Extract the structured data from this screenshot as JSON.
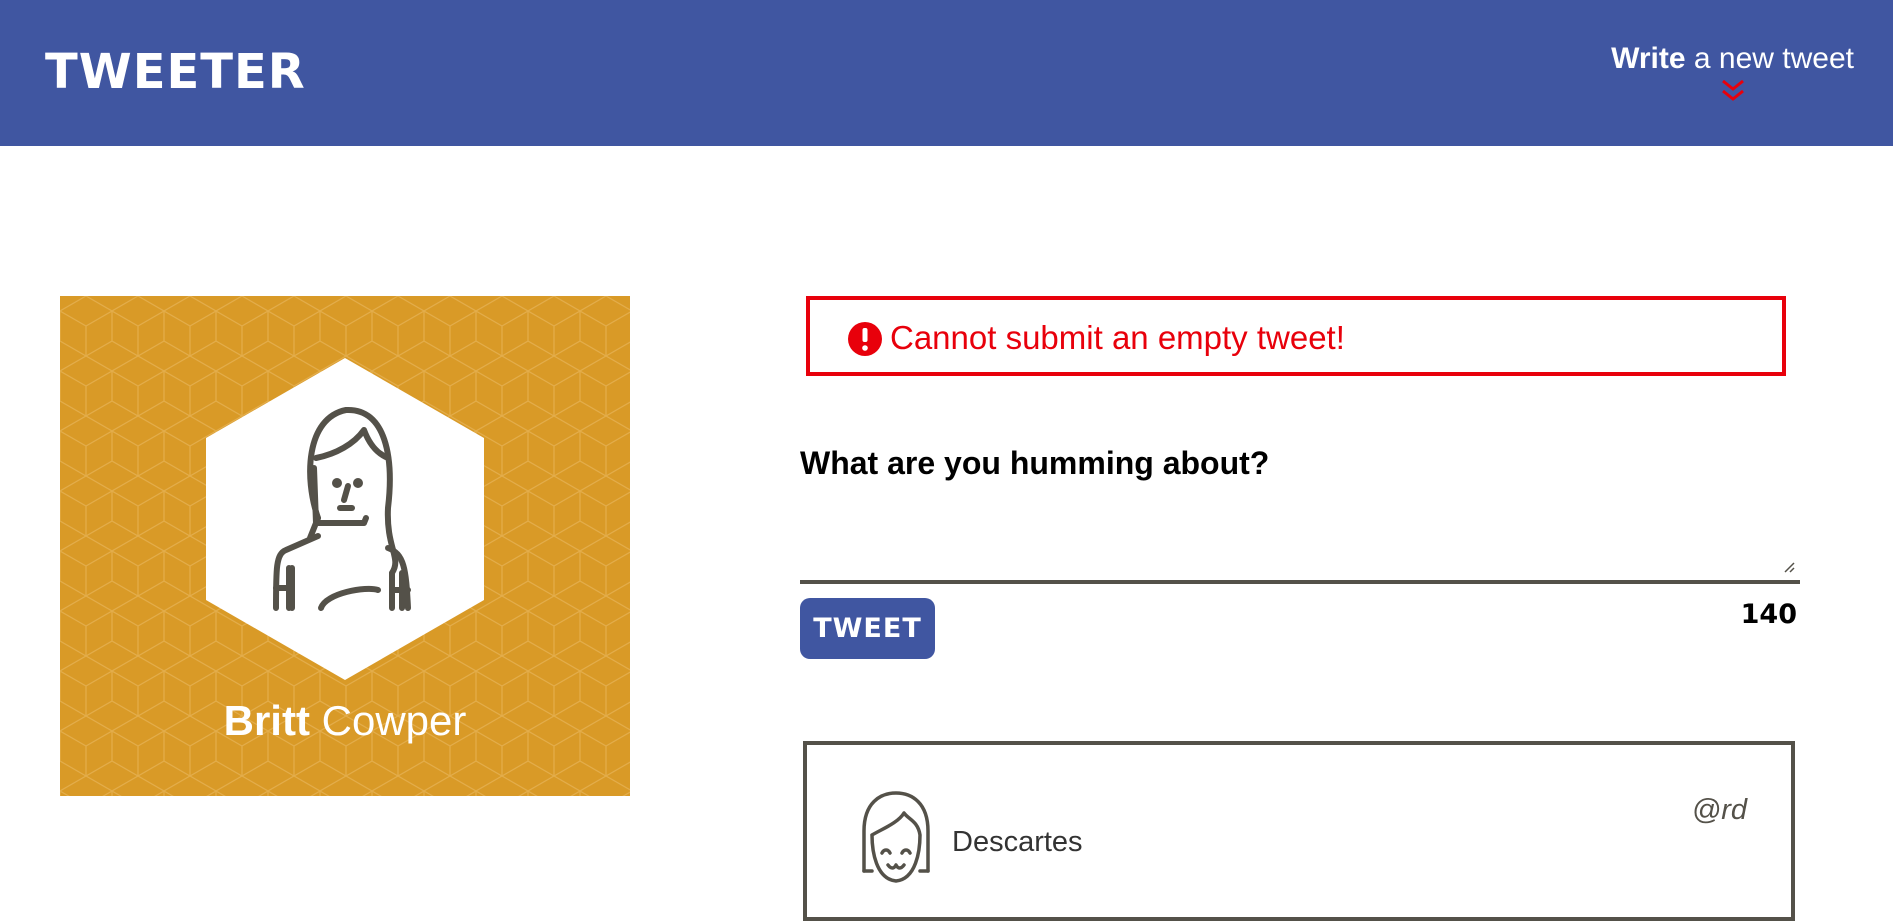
{
  "header": {
    "logo": "TWEETER",
    "compose_bold": "Write",
    "compose_rest": " a new tweet",
    "compose_icon": "double-chevron-down-icon"
  },
  "profile": {
    "first_name": "Britt",
    "last_name": "Cowper",
    "background_color": "#d99a27",
    "avatar_icon": "woman-avatar-icon"
  },
  "error": {
    "message": "Cannot submit an empty tweet!",
    "color": "#e8000b",
    "icon": "exclamation-circle-icon"
  },
  "compose": {
    "prompt": "What are you humming about?",
    "value": "",
    "button_label": "TWEET",
    "char_count": "140"
  },
  "tweets": [
    {
      "name": "Descartes",
      "handle": "@rd",
      "avatar_icon": "smiling-girl-avatar-icon"
    }
  ],
  "colors": {
    "nav": "#4056a1",
    "accent_red": "#e8000b",
    "border": "#545149"
  }
}
